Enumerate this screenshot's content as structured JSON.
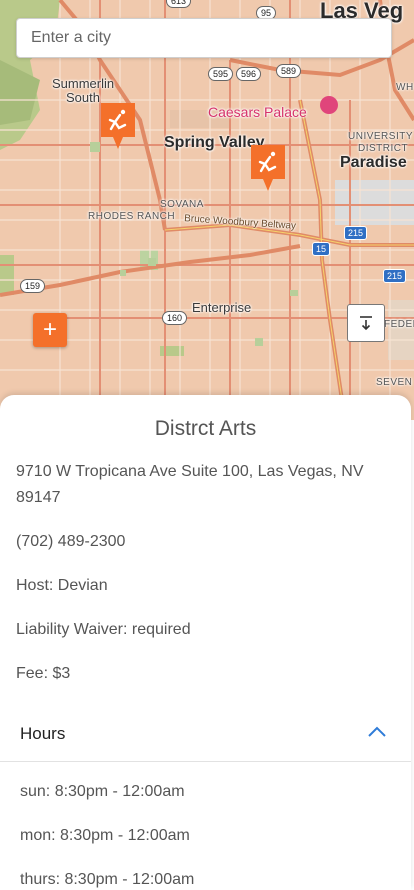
{
  "search": {
    "placeholder": "Enter a city"
  },
  "map": {
    "labels": {
      "las_vegas": "Las Veg",
      "summerlin_south_1": "Summerlin",
      "summerlin_south_2": "South",
      "spring_valley": "Spring Valley",
      "caesars_palace": "Caesars Palace",
      "paradise": "Paradise",
      "university_1": "UNIVERSITY",
      "university_2": "DISTRICT",
      "rhodes_ranch": "RHODES RANCH",
      "sovana": "SOVANA",
      "bruce_woodbury": "Bruce Woodbury Beltway",
      "enterprise": "Enterprise",
      "federal": "FEDERA",
      "seven": "SEVEN",
      "wh": "WH"
    },
    "shields": {
      "r613": "613",
      "r95": "95",
      "r595": "595",
      "r596": "596",
      "r589": "589",
      "r215a": "215",
      "r15": "15",
      "r215b": "215",
      "r159": "159",
      "r160": "160"
    },
    "pin_icon": "parkour-icon",
    "add_label": "+",
    "accent": "#f4702a"
  },
  "venue": {
    "name": "Distrct Arts",
    "address": "9710 W Tropicana Ave Suite 100, Las Vegas, NV 89147",
    "phone": "(702) 489-2300",
    "host": "Host: Devian",
    "waiver": "Liability Waiver: required",
    "fee": "Fee: $3",
    "hours_title": "Hours",
    "hours": [
      "sun: 8:30pm - 12:00am",
      "mon: 8:30pm - 12:00am",
      "thurs: 8:30pm - 12:00am"
    ]
  }
}
